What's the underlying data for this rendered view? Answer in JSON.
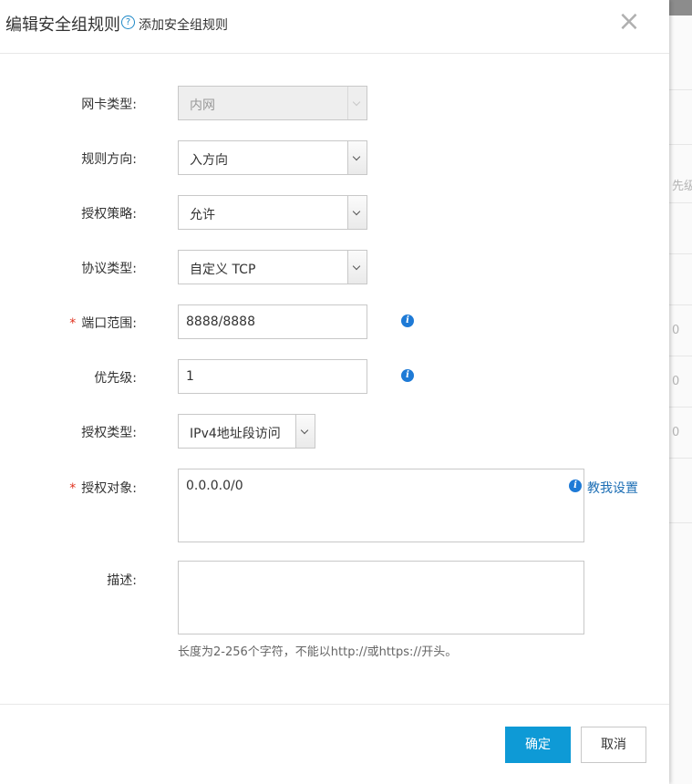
{
  "background": {
    "fragments": [
      "先级",
      "0",
      "0",
      "0"
    ]
  },
  "dialog": {
    "title": "编辑安全组规则",
    "help_link": "添加安全组规则",
    "close": "×"
  },
  "form": {
    "nic_type": {
      "label": "网卡类型:",
      "value": "内网"
    },
    "direction": {
      "label": "规则方向:",
      "value": "入方向"
    },
    "policy": {
      "label": "授权策略:",
      "value": "允许"
    },
    "protocol": {
      "label": "协议类型:",
      "value": "自定义 TCP"
    },
    "port_range": {
      "label": "端口范围:",
      "value": "8888/8888",
      "required": "*"
    },
    "priority": {
      "label": "优先级:",
      "value": "1"
    },
    "auth_type": {
      "label": "授权类型:",
      "value": "IPv4地址段访问"
    },
    "auth_object": {
      "label": "授权对象:",
      "value": "0.0.0.0/0",
      "required": "*",
      "help_link": "教我设置"
    },
    "description": {
      "label": "描述:",
      "value": "",
      "hint": "长度为2-256个字符，不能以http://或https://开头。"
    }
  },
  "footer": {
    "confirm": "确定",
    "cancel": "取消"
  },
  "colors": {
    "primary": "#0e9ad6",
    "link": "#1e6fb5",
    "required": "#e0321e",
    "info": "#1e7ad6"
  }
}
